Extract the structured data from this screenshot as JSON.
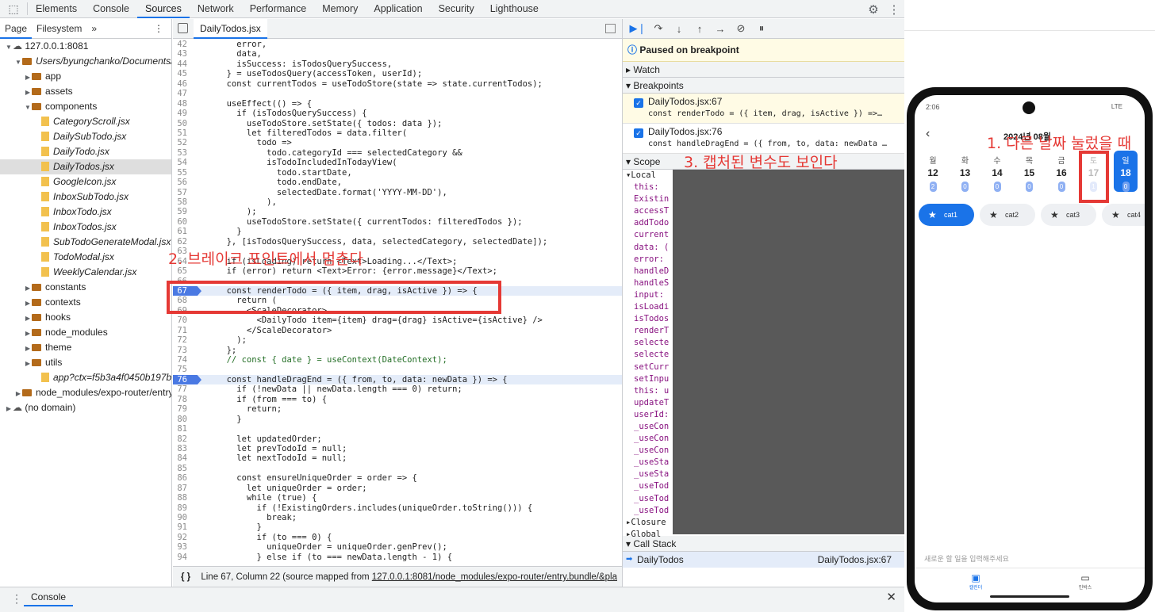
{
  "devtools": {
    "tabs": [
      "Elements",
      "Console",
      "Sources",
      "Network",
      "Performance",
      "Memory",
      "Application",
      "Security",
      "Lighthouse"
    ],
    "active_tab": "Sources"
  },
  "navigator": {
    "tabs": [
      "Page",
      "Filesystem"
    ],
    "tree": [
      {
        "label": "127.0.0.1:8081",
        "indent": 0,
        "kind": "cloud",
        "open": true
      },
      {
        "label": "Users/byungchanko/Documents/",
        "indent": 1,
        "kind": "folder",
        "open": true,
        "italic": true
      },
      {
        "label": "app",
        "indent": 2,
        "kind": "folder",
        "open": false
      },
      {
        "label": "assets",
        "indent": 2,
        "kind": "folder",
        "open": false
      },
      {
        "label": "components",
        "indent": 2,
        "kind": "folder",
        "open": true
      },
      {
        "label": "CategoryScroll.jsx",
        "indent": 3,
        "kind": "file"
      },
      {
        "label": "DailySubTodo.jsx",
        "indent": 3,
        "kind": "file"
      },
      {
        "label": "DailyTodo.jsx",
        "indent": 3,
        "kind": "file"
      },
      {
        "label": "DailyTodos.jsx",
        "indent": 3,
        "kind": "file",
        "selected": true
      },
      {
        "label": "GoogleIcon.jsx",
        "indent": 3,
        "kind": "file"
      },
      {
        "label": "InboxSubTodo.jsx",
        "indent": 3,
        "kind": "file"
      },
      {
        "label": "InboxTodo.jsx",
        "indent": 3,
        "kind": "file"
      },
      {
        "label": "InboxTodos.jsx",
        "indent": 3,
        "kind": "file"
      },
      {
        "label": "SubTodoGenerateModal.jsx",
        "indent": 3,
        "kind": "file"
      },
      {
        "label": "TodoModal.jsx",
        "indent": 3,
        "kind": "file"
      },
      {
        "label": "WeeklyCalendar.jsx",
        "indent": 3,
        "kind": "file"
      },
      {
        "label": "constants",
        "indent": 2,
        "kind": "folder",
        "open": false
      },
      {
        "label": "contexts",
        "indent": 2,
        "kind": "folder",
        "open": false
      },
      {
        "label": "hooks",
        "indent": 2,
        "kind": "folder",
        "open": false
      },
      {
        "label": "node_modules",
        "indent": 2,
        "kind": "folder",
        "open": false
      },
      {
        "label": "theme",
        "indent": 2,
        "kind": "folder",
        "open": false
      },
      {
        "label": "utils",
        "indent": 2,
        "kind": "folder",
        "open": false
      },
      {
        "label": "app?ctx=f5b3a4f0450b197b88",
        "indent": 3,
        "kind": "file"
      },
      {
        "label": "node_modules/expo-router/entry",
        "indent": 1,
        "kind": "folder",
        "open": false
      },
      {
        "label": "(no domain)",
        "indent": 0,
        "kind": "cloud",
        "open": false
      }
    ]
  },
  "editor": {
    "file_tab": "DailyTodos.jsx",
    "lines": [
      {
        "n": "42",
        "t": "    error,"
      },
      {
        "n": "43",
        "t": "    data,"
      },
      {
        "n": "44",
        "t": "    isSuccess: isTodosQuerySuccess,"
      },
      {
        "n": "45",
        "t": "  } = useTodosQuery(accessToken, userId);"
      },
      {
        "n": "46",
        "t": "  const currentTodos = useTodoStore(state => state.currentTodos);"
      },
      {
        "n": "47",
        "t": ""
      },
      {
        "n": "48",
        "t": "  useEffect(() => {"
      },
      {
        "n": "49",
        "t": "    if (isTodosQuerySuccess) {"
      },
      {
        "n": "50",
        "t": "      useTodoStore.setState({ todos: data });"
      },
      {
        "n": "51",
        "t": "      let filteredTodos = data.filter("
      },
      {
        "n": "52",
        "t": "        todo =>"
      },
      {
        "n": "53",
        "t": "          todo.categoryId === selectedCategory &&"
      },
      {
        "n": "54",
        "t": "          isTodoIncludedInTodayView("
      },
      {
        "n": "55",
        "t": "            todo.startDate,"
      },
      {
        "n": "56",
        "t": "            todo.endDate,"
      },
      {
        "n": "57",
        "t": "            selectedDate.format('YYYY-MM-DD'),"
      },
      {
        "n": "58",
        "t": "          ),"
      },
      {
        "n": "59",
        "t": "      );"
      },
      {
        "n": "60",
        "t": "      useTodoStore.setState({ currentTodos: filteredTodos });"
      },
      {
        "n": "61",
        "t": "    }"
      },
      {
        "n": "62",
        "t": "  }, [isTodosQuerySuccess, data, selectedCategory, selectedDate]);"
      },
      {
        "n": "63",
        "t": ""
      },
      {
        "n": "64",
        "t": "  if (isLoading) return <Text>Loading...</Text>;"
      },
      {
        "n": "65",
        "t": "  if (error) return <Text>Error: {error.message}</Text>;"
      },
      {
        "n": "66",
        "t": ""
      },
      {
        "n": "67",
        "t": "  const renderTodo = ({ item, drag, isActive }) => {",
        "bp": true
      },
      {
        "n": "68",
        "t": "    return ("
      },
      {
        "n": "69",
        "t": "      <ScaleDecorator>"
      },
      {
        "n": "70",
        "t": "        <DailyTodo item={item} drag={drag} isActive={isActive} />"
      },
      {
        "n": "71",
        "t": "      </ScaleDecorator>"
      },
      {
        "n": "72",
        "t": "    );"
      },
      {
        "n": "73",
        "t": "  };"
      },
      {
        "n": "74",
        "t": "  // const { date } = useContext(DateContext);"
      },
      {
        "n": "75",
        "t": ""
      },
      {
        "n": "76",
        "t": "  const handleDragEnd = ({ from, to, data: newData }) => {",
        "bp": true
      },
      {
        "n": "77",
        "t": "    if (!newData || newData.length === 0) return;"
      },
      {
        "n": "78",
        "t": "    if (from === to) {"
      },
      {
        "n": "79",
        "t": "      return;"
      },
      {
        "n": "80",
        "t": "    }"
      },
      {
        "n": "81",
        "t": ""
      },
      {
        "n": "82",
        "t": "    let updatedOrder;"
      },
      {
        "n": "83",
        "t": "    let prevTodoId = null;"
      },
      {
        "n": "84",
        "t": "    let nextTodoId = null;"
      },
      {
        "n": "85",
        "t": ""
      },
      {
        "n": "86",
        "t": "    const ensureUniqueOrder = order => {"
      },
      {
        "n": "87",
        "t": "      let uniqueOrder = order;"
      },
      {
        "n": "88",
        "t": "      while (true) {"
      },
      {
        "n": "89",
        "t": "        if (!ExistingOrders.includes(uniqueOrder.toString())) {"
      },
      {
        "n": "90",
        "t": "          break;"
      },
      {
        "n": "91",
        "t": "        }"
      },
      {
        "n": "92",
        "t": "        if (to === 0) {"
      },
      {
        "n": "93",
        "t": "          uniqueOrder = uniqueOrder.genPrev();"
      },
      {
        "n": "94",
        "t": "        } else if (to === newData.length - 1) {"
      }
    ],
    "status_text": "Line 67, Column 22  (source mapped from ",
    "status_link": "127.0.0.1:8081/node_modules/expo-router/entry.bundle/&pla"
  },
  "debugger": {
    "paused_text": "Paused on breakpoint",
    "watch_label": "Watch",
    "breakpoints_label": "Breakpoints",
    "breakpoints": [
      {
        "file": "DailyTodos.jsx:67",
        "code": "const renderTodo = ({ item, drag, isActive }) =>…"
      },
      {
        "file": "DailyTodos.jsx:76",
        "code": "const handleDragEnd = ({ from, to, data: newData …"
      }
    ],
    "scope_label": "Scope",
    "scope_local": "Local",
    "scope_vars": [
      "this:",
      "Existin",
      "accessT",
      "addTodo",
      "current",
      "data: (",
      "error:",
      "handleD",
      "handleS",
      "input:",
      "isLoadi",
      "isTodos",
      "renderT",
      "selecte",
      "selecte",
      "setCurr",
      "setInpu",
      "this: u",
      "updateT",
      "userId:",
      "_useCon",
      "_useCon",
      "_useCon",
      "_useSta",
      "_useSta",
      "_useTod",
      "_useTod",
      "_useTod"
    ],
    "closure_label": "Closure",
    "global_label": "Global",
    "callstack_label": "Call Stack",
    "callstack_fn": "DailyTodos",
    "callstack_loc": "DailyTodos.jsx:67"
  },
  "console_label": "Console",
  "phone": {
    "status_time": "2:06",
    "status_net": "LTE",
    "header_date": "2024년 08월",
    "days": [
      {
        "w": "월",
        "d": "12",
        "c": "2"
      },
      {
        "w": "화",
        "d": "13",
        "c": "0"
      },
      {
        "w": "수",
        "d": "14",
        "c": "0"
      },
      {
        "w": "목",
        "d": "15",
        "c": "0"
      },
      {
        "w": "금",
        "d": "16",
        "c": "0"
      },
      {
        "w": "토",
        "d": "17",
        "c": "1"
      },
      {
        "w": "일",
        "d": "18",
        "c": "0"
      }
    ],
    "categories": [
      "cat1",
      "cat2",
      "cat3",
      "cat4"
    ],
    "input_placeholder": "새로운 할 일을 입력해주세요",
    "nav": [
      "캘린더",
      "인박스"
    ]
  },
  "annotations": {
    "a1": "1. 다른 날짜 눌렀을 때",
    "a2": "2. 브레이크 포인트에서 멈춘다",
    "a3": "3. 캡처된 변수도 보인다"
  }
}
